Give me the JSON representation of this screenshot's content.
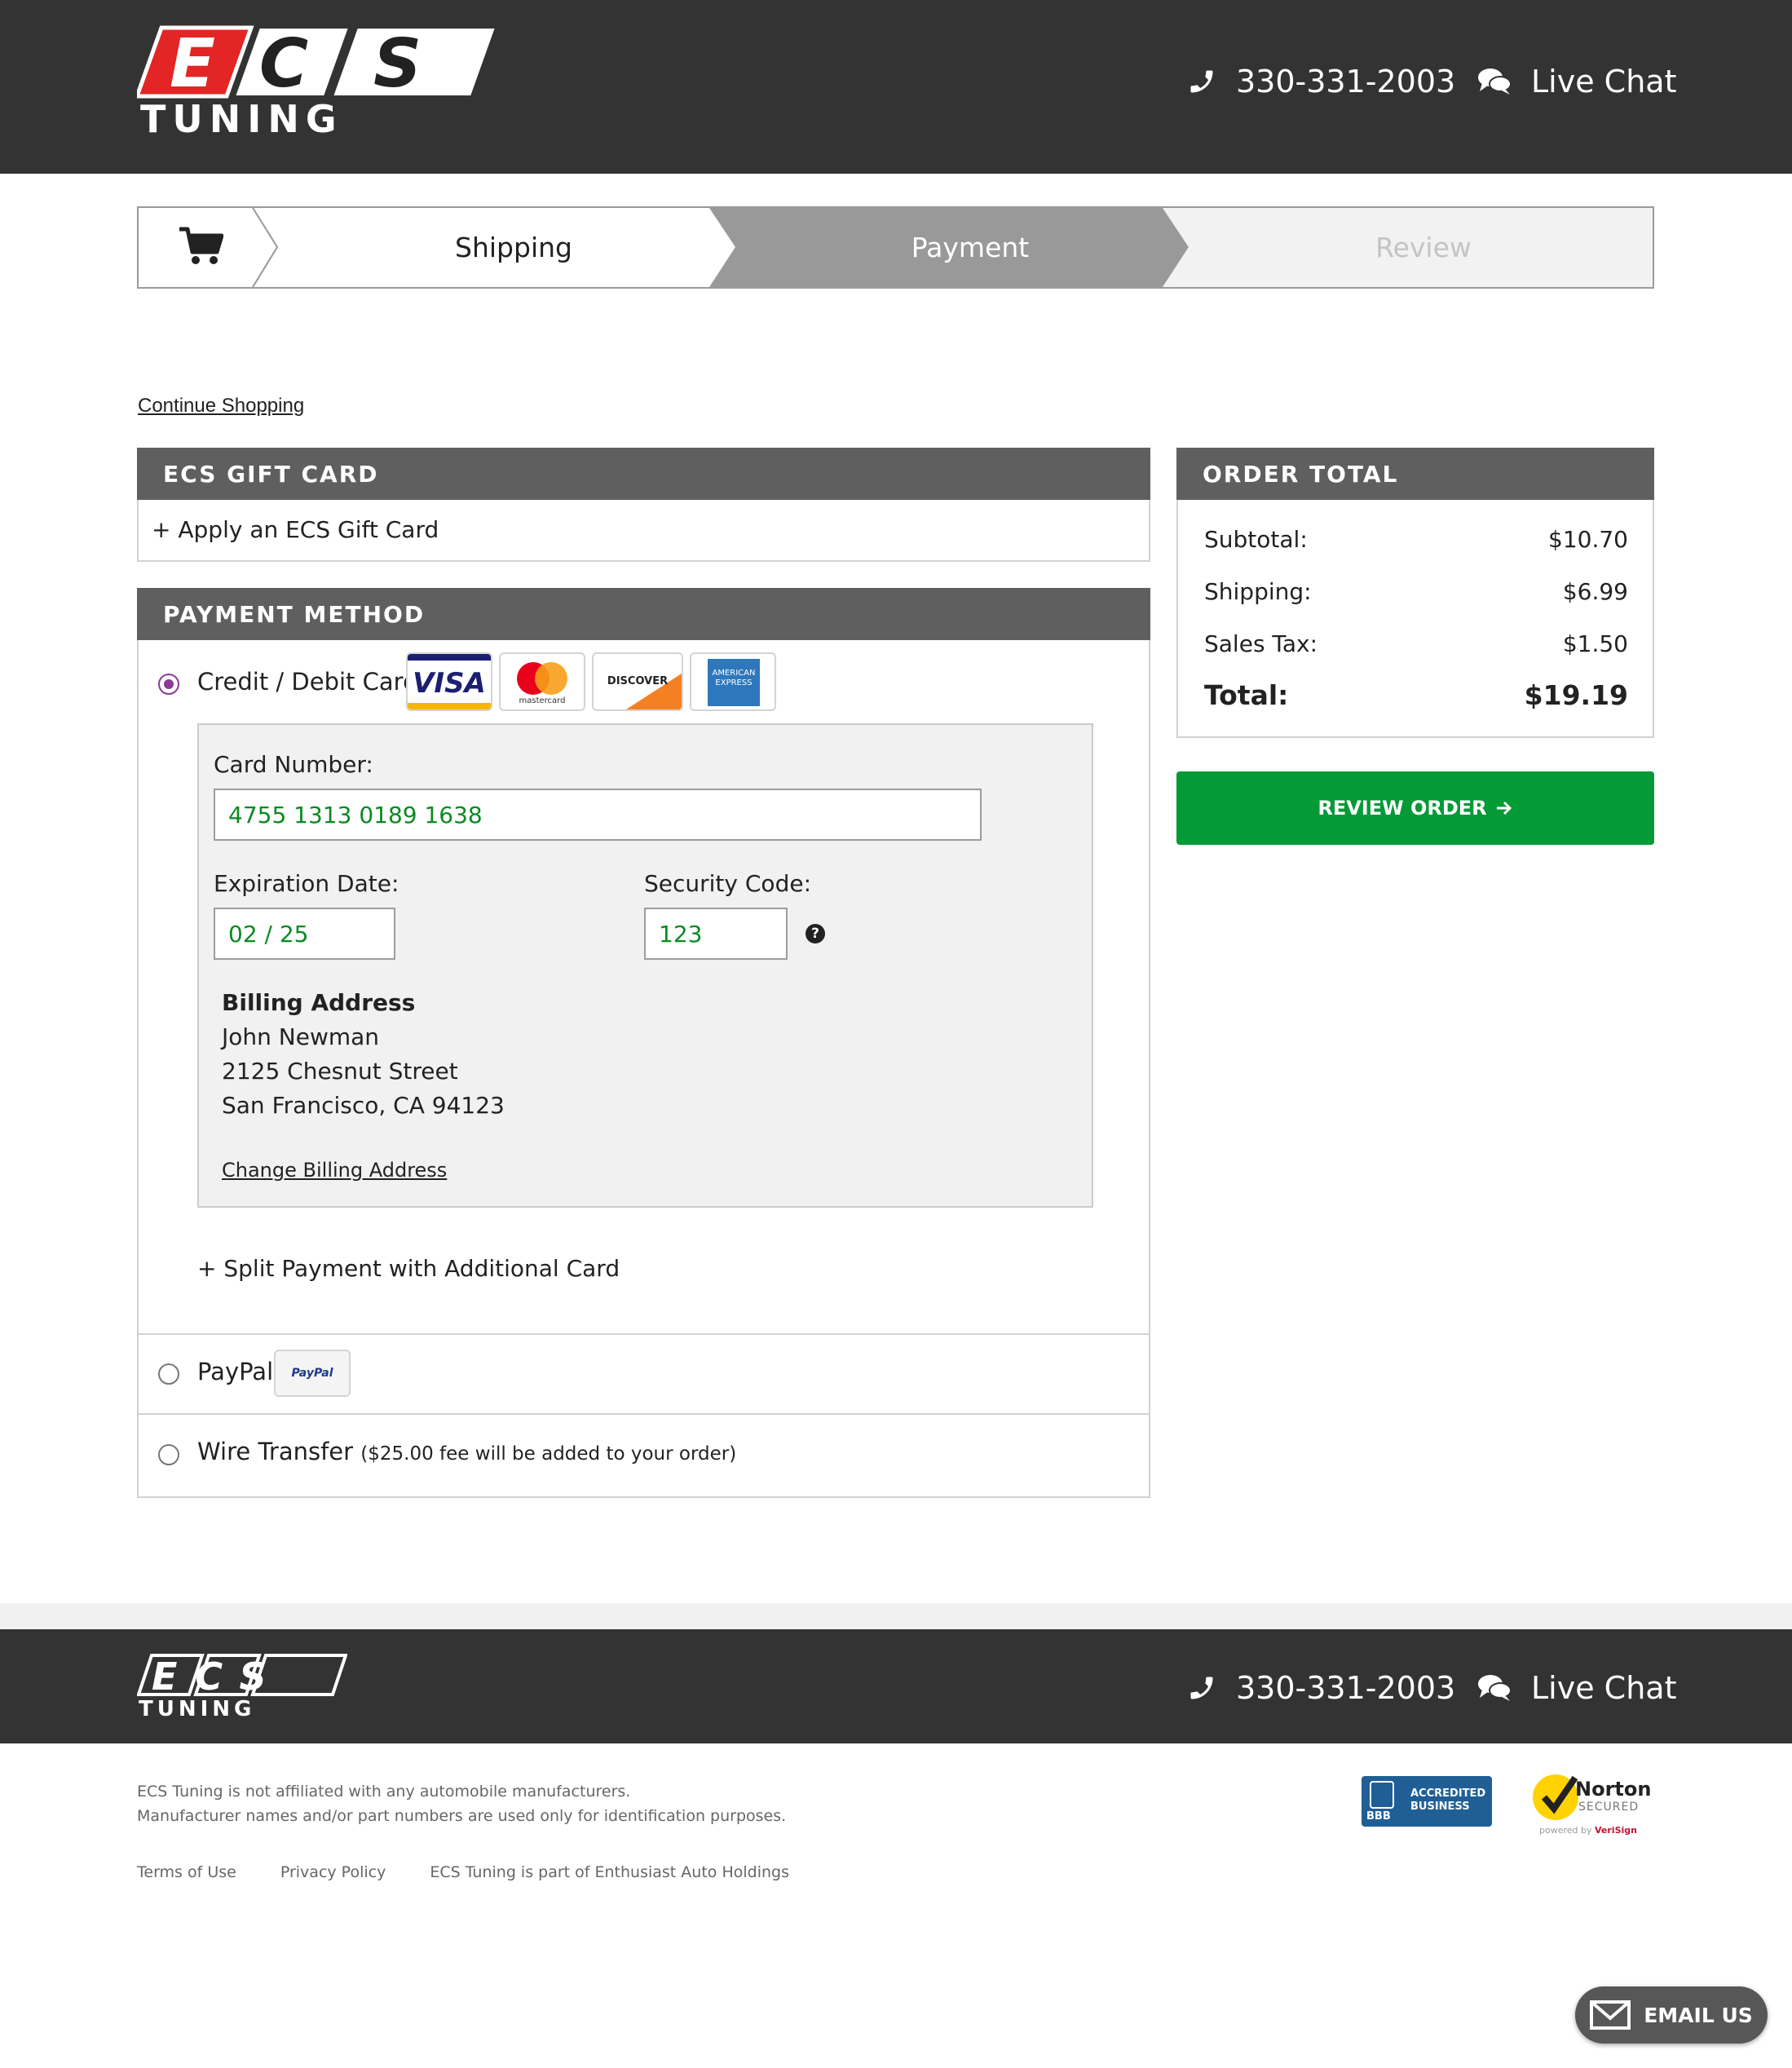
{
  "header": {
    "logo_text_top": "ECS",
    "logo_text_bottom": "TUNING",
    "phone": "330-331-2003",
    "live_chat": "Live Chat"
  },
  "progress": {
    "steps": [
      {
        "label": "Shipping",
        "state": "complete"
      },
      {
        "label": "Payment",
        "state": "current"
      },
      {
        "label": "Review",
        "state": "upcoming"
      }
    ]
  },
  "continue_shopping": "Continue Shopping",
  "gift_card": {
    "heading": "ECS GIFT CARD",
    "apply_link": "+ Apply an ECS Gift Card"
  },
  "payment_method": {
    "heading": "PAYMENT METHOD",
    "credit_option": "Credit / Debit Card",
    "card_brands": [
      "VISA",
      "mastercard",
      "DISCOVER",
      "AMERICAN EXPRESS"
    ],
    "card_number_label": "Card Number:",
    "card_number_value": "4755 1313 0189 1638",
    "expiration_label": "Expiration Date:",
    "expiration_value": "02 / 25",
    "security_label": "Security Code:",
    "security_value": "123",
    "billing": {
      "title": "Billing Address",
      "name": "John Newman",
      "street": "2125 Chesnut Street",
      "city": "San Francisco, CA 94123",
      "change_link": "Change Billing Address"
    },
    "split_payment": "+ Split Payment with Additional Card",
    "paypal_option": "PayPal",
    "paypal_logo": "PayPal",
    "wire_option": "Wire Transfer",
    "wire_note": "($25.00 fee will be added to your order)",
    "selected": "credit"
  },
  "order_total": {
    "heading": "ORDER TOTAL",
    "rows": [
      {
        "label": "Subtotal:",
        "value": "$10.70"
      },
      {
        "label": "Shipping:",
        "value": "$6.99"
      },
      {
        "label": "Sales Tax:",
        "value": "$1.50"
      }
    ],
    "total_label": "Total:",
    "total_value": "$19.19"
  },
  "review_button": "REVIEW ORDER",
  "footer": {
    "phone": "330-331-2003",
    "live_chat": "Live Chat",
    "disclaimer_1": "ECS Tuning is not affiliated with any automobile manufacturers.",
    "disclaimer_2": "Manufacturer names and/or part numbers are used only for identification purposes.",
    "links": [
      "Terms of Use",
      "Privacy Policy",
      "ECS Tuning is part of Enthusiast Auto Holdings"
    ],
    "bbb_line1": "ACCREDITED",
    "bbb_line2": "BUSINESS",
    "bbb_mark": "BBB",
    "norton_line1": "Norton",
    "norton_line2": "SECURED",
    "norton_line3_a": "powered by",
    "norton_line3_b": "VeriSign"
  },
  "email_us": "EMAIL US",
  "colors": {
    "header_bg": "#333333",
    "panel_head": "#5f5f5f",
    "accent_green": "#049a36",
    "field_text_green": "#0a8a22",
    "radio_purple": "#8c3a96",
    "logo_red": "#e32526"
  }
}
